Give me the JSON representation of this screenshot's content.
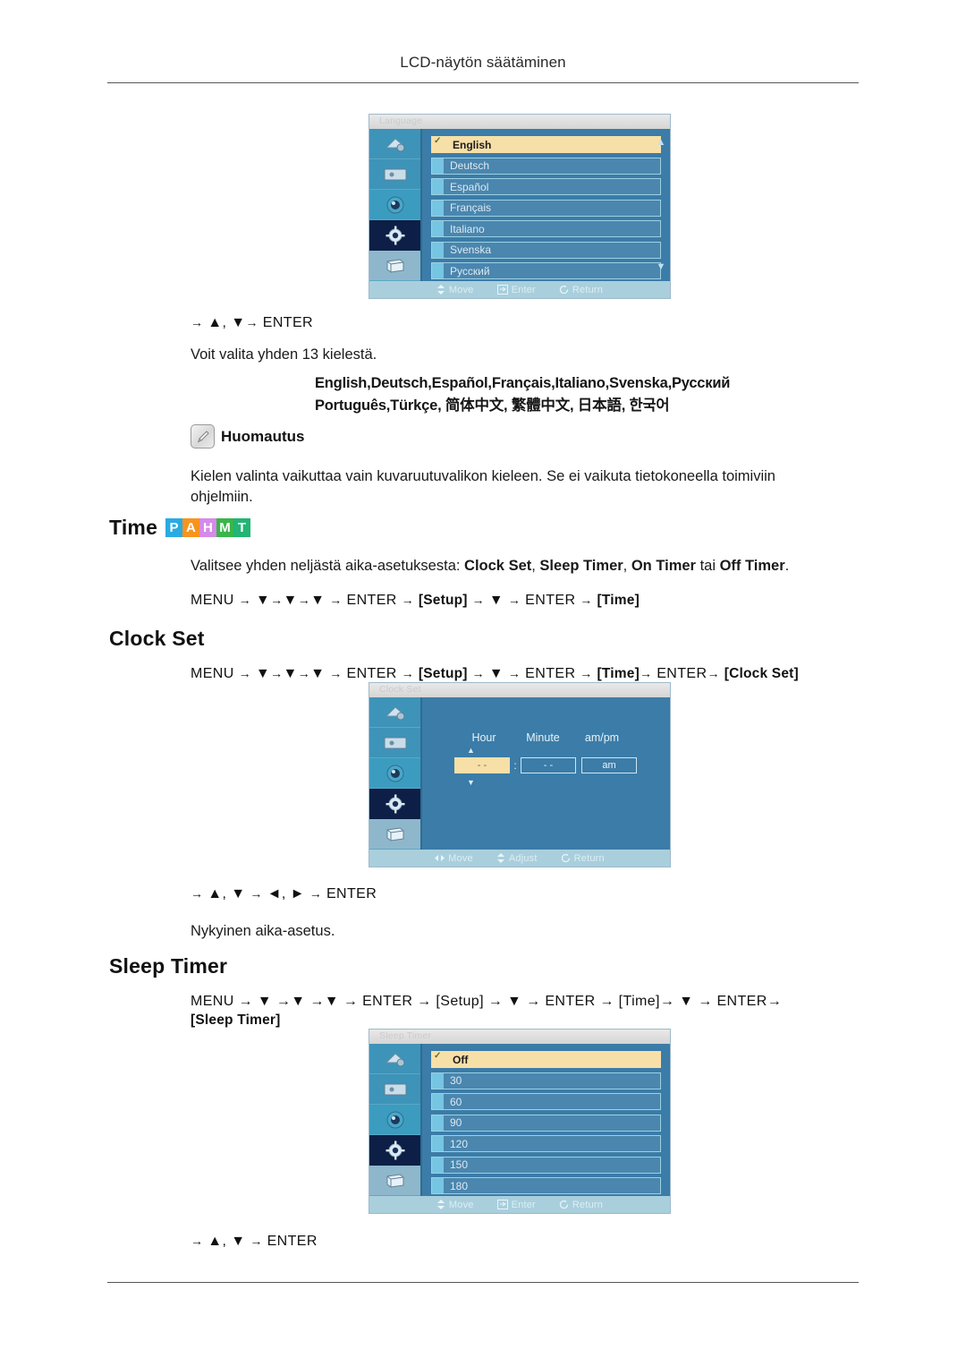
{
  "document": {
    "running_header": "LCD-näytön säätäminen"
  },
  "language_section": {
    "osd": {
      "title": "Language",
      "options": [
        {
          "label": "English",
          "selected": true
        },
        {
          "label": "Deutsch",
          "selected": false
        },
        {
          "label": "Español",
          "selected": false
        },
        {
          "label": "Français",
          "selected": false
        },
        {
          "label": "Italiano",
          "selected": false
        },
        {
          "label": "Svenska",
          "selected": false
        },
        {
          "label": "Русский",
          "selected": false
        }
      ],
      "scroll_up": "▲",
      "scroll_down": "▼",
      "footer": {
        "move": "Move",
        "enter": "Enter",
        "return": "Return"
      }
    },
    "nav": {
      "prefix": "→",
      "up": "▲",
      "comma": ",",
      "down": "▼",
      "arrow": "→",
      "enter": "ENTER"
    },
    "description": "Voit valita yhden 13 kielestä.",
    "language_list_line1": "English,Deutsch,Español,Français,Italiano,Svenska,Русский",
    "language_list_line2": "Português,Türkçe, 简体中文,  繁體中文, 日本語, 한국어"
  },
  "note": {
    "icon": "note-pencil-icon",
    "label": "Huomautus",
    "text_line1": "Kielen valinta vaikuttaa vain kuvaruutuvalikon kieleen. Se ei vaikuta tietokoneella toimiviin",
    "text_line2": "ohjelmiin."
  },
  "time_section": {
    "heading": "Time",
    "badges": [
      {
        "letter": "P",
        "color": "#29abe2"
      },
      {
        "letter": "A",
        "color": "#f7941e"
      },
      {
        "letter": "H",
        "color": "#d68ae8"
      },
      {
        "letter": "M",
        "color": "#39b54a"
      },
      {
        "letter": "T",
        "color": "#22b573"
      }
    ],
    "description_prefix": "Valitsee yhden neljästä aika-asetuksesta: ",
    "description_items": [
      "Clock Set",
      "Sleep Timer",
      "On Timer"
    ],
    "description_conj": " tai ",
    "description_last": "Off Timer",
    "description_suffix": ".",
    "nav": {
      "menu": "MENU",
      "arrow": "→",
      "down": "▼",
      "enter": "ENTER",
      "setup": "[Setup]",
      "time": "[Time]"
    }
  },
  "clock_set_section": {
    "heading": "Clock Set",
    "nav": {
      "menu": "MENU",
      "arrow": "→",
      "down": "▼",
      "enter": "ENTER",
      "setup": "[Setup]",
      "time": "[Time]",
      "clock_set": "[Clock Set]"
    },
    "osd": {
      "title": "Clock Set",
      "columns": [
        "Hour",
        "Minute",
        "am/pm"
      ],
      "hour_value": "- -",
      "minute_value": "- -",
      "ampm_value": "am",
      "colon": ":",
      "up_arrow": "▲",
      "down_arrow": "▼",
      "footer": {
        "move": "Move",
        "adjust": "Adjust",
        "return": "Return"
      }
    },
    "nav_keys": {
      "prefix": "→",
      "up": "▲",
      "comma": ",",
      "down": "▼",
      "left": "◄",
      "right": "►",
      "arrow": "→",
      "enter": "ENTER"
    },
    "description": "Nykyinen aika-asetus."
  },
  "sleep_timer_section": {
    "heading": "Sleep Timer",
    "nav_line1": "MENU  →  ▼  →▼  →▼  →  ENTER  →  [Setup]  →  ▼  →  ENTER  →  [Time]→  ▼  →  ENTER→",
    "nav_line2": "[Sleep Timer]",
    "osd": {
      "title": "Sleep Timer",
      "options": [
        {
          "label": "Off",
          "selected": true
        },
        {
          "label": "30",
          "selected": false
        },
        {
          "label": "60",
          "selected": false
        },
        {
          "label": "90",
          "selected": false
        },
        {
          "label": "120",
          "selected": false
        },
        {
          "label": "150",
          "selected": false
        },
        {
          "label": "180",
          "selected": false
        }
      ],
      "footer": {
        "move": "Move",
        "enter": "Enter",
        "return": "Return"
      }
    },
    "nav_keys": {
      "prefix": "→",
      "up": "▲",
      "comma": ",",
      "down": "▼",
      "arrow": "→",
      "enter": "ENTER"
    }
  }
}
